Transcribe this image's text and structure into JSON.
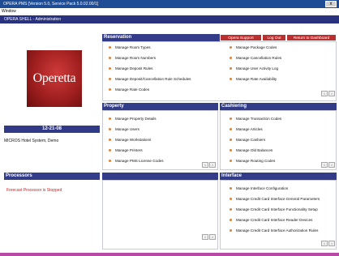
{
  "window": {
    "title": "OPERA PMS [Version 5.0, Service Pack 5.0.02.00/1]",
    "control": "x"
  },
  "menu": {
    "window": "Window"
  },
  "module": {
    "title": "OPERA SHELL - Administration"
  },
  "logo": {
    "text": "Operetta"
  },
  "date": "12-21-08",
  "system_name": "MICROS Hotel System, Demo",
  "top_buttons": {
    "opera_support": "Opera Support",
    "log_out": "Log Out",
    "return_dashboard": "Return to Dashboard"
  },
  "nav": {
    "prev": "<",
    "next": ">"
  },
  "sections": {
    "reservation": {
      "title": "Reservation",
      "left": [
        "Manage Room Types",
        "Manage Room Numbers",
        "Manage Deposit Rules",
        "Manage Deposit/Cancellation Rule Schedules",
        "Manage Rate Codes"
      ],
      "right": [
        "Manage Package Codes",
        "Manage Cancellation Rules",
        "Manage User Activity Log",
        "Manage Rate Availability"
      ]
    },
    "property": {
      "title": "Property",
      "items": [
        "Manage Property Details",
        "Manage Users",
        "Manage Workstations",
        "Manage Printers",
        "Manage PMS License Codes"
      ]
    },
    "cashiering": {
      "title": "Cashiering",
      "items": [
        "Manage Transaction Codes",
        "Manage Articles",
        "Manage Cashiers",
        "Manage Old Balances",
        "Manage Routing Codes"
      ]
    },
    "processors": {
      "title": "Processors",
      "message": "Forecast Processor is Stopped"
    },
    "blank": {
      "title": ""
    },
    "interface": {
      "title": "Interface",
      "items": [
        "Manage Interface Configuration",
        "Manage Credit Card Interface General Parameters",
        "Manage Credit Card Interface Functionality Setup",
        "Manage Credit Card Interface Reader Devices",
        "Manage Credit Card Interface Authorization Rules"
      ]
    }
  },
  "colors": {
    "header": "#323c88",
    "titlebar": "#1e4d96",
    "accent_button": "#ba3030",
    "bullet": "#e2802a",
    "footer": "#b64aa6",
    "warning_text": "#d42020"
  }
}
